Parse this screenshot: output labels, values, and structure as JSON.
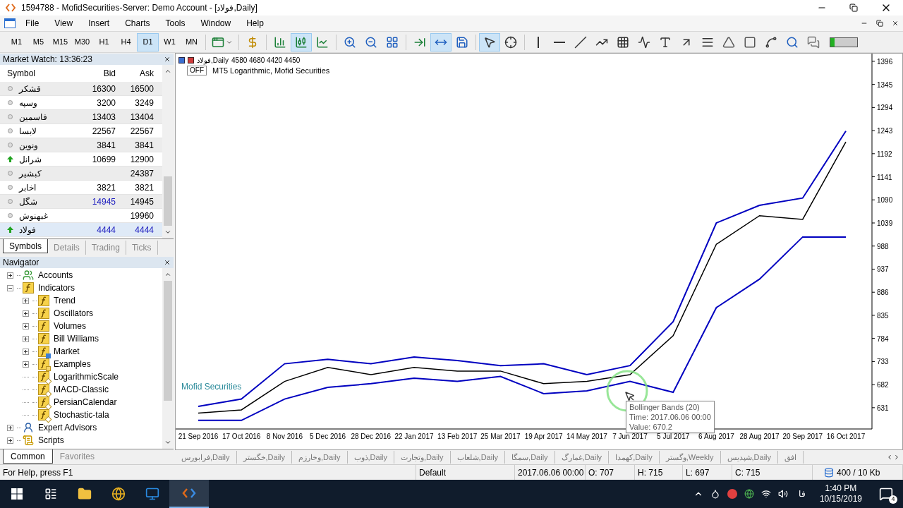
{
  "window": {
    "title": "1594788 - MofidSecurities-Server: Demo Account - [فولاد,Daily]"
  },
  "menu": [
    "File",
    "View",
    "Insert",
    "Charts",
    "Tools",
    "Window",
    "Help"
  ],
  "timeframes": [
    {
      "label": "M1",
      "selected": false
    },
    {
      "label": "M5",
      "selected": false
    },
    {
      "label": "M15",
      "selected": false
    },
    {
      "label": "M30",
      "selected": false
    },
    {
      "label": "H1",
      "selected": false
    },
    {
      "label": "H4",
      "selected": false
    },
    {
      "label": "D1",
      "selected": true
    },
    {
      "label": "W1",
      "selected": false
    },
    {
      "label": "MN",
      "selected": false
    }
  ],
  "toolbar_tools": [
    {
      "selected": false
    },
    {
      "selected": false
    },
    {
      "selected": false
    },
    {
      "selected": true
    },
    {
      "selected": false
    },
    {
      "selected": false
    },
    {
      "selected": false
    },
    {
      "selected": false
    },
    {
      "selected": false
    },
    {
      "selected": true
    },
    {
      "selected": false
    },
    {
      "selected": true
    },
    {
      "selected": false
    },
    {
      "selected": false
    },
    {
      "selected": false
    },
    {
      "selected": false
    },
    {
      "selected": false
    },
    {
      "selected": false
    },
    {
      "selected": false
    },
    {
      "selected": false
    },
    {
      "selected": false
    },
    {
      "selected": false
    },
    {
      "selected": false
    },
    {
      "selected": false
    },
    {
      "selected": false
    },
    {
      "selected": false
    },
    {
      "selected": false
    }
  ],
  "market_watch": {
    "title": "Market Watch: 13:36:23",
    "columns": [
      "Symbol",
      "Bid",
      "Ask"
    ],
    "rows": [
      {
        "symbol": "قشکر",
        "bid": "16300",
        "ask": "16500",
        "kind": "flat",
        "bid_highlight": false,
        "ask_highlight": false,
        "selected": false
      },
      {
        "symbol": "وسپه",
        "bid": "3200",
        "ask": "3249",
        "kind": "flat",
        "bid_highlight": false,
        "ask_highlight": false,
        "selected": false
      },
      {
        "symbol": "فاسمین",
        "bid": "13403",
        "ask": "13404",
        "kind": "flat",
        "bid_highlight": false,
        "ask_highlight": false,
        "selected": false
      },
      {
        "symbol": "لابسا",
        "bid": "22567",
        "ask": "22567",
        "kind": "flat",
        "bid_highlight": false,
        "ask_highlight": false,
        "selected": false
      },
      {
        "symbol": "ونوین",
        "bid": "3841",
        "ask": "3841",
        "kind": "flat",
        "bid_highlight": false,
        "ask_highlight": false,
        "selected": false
      },
      {
        "symbol": "شرانل",
        "bid": "10699",
        "ask": "12900",
        "kind": "up",
        "bid_highlight": false,
        "ask_highlight": false,
        "selected": false
      },
      {
        "symbol": "کبشیر",
        "ask": "24387",
        "kind": "flat",
        "ask_highlight": false,
        "selected": false
      },
      {
        "symbol": "اخابر",
        "bid": "3821",
        "ask": "3821",
        "kind": "flat",
        "bid_highlight": false,
        "ask_highlight": false,
        "selected": false
      },
      {
        "symbol": "شگل",
        "bid": "14945",
        "ask": "14945",
        "kind": "flat",
        "bid_highlight": true,
        "ask_highlight": false,
        "selected": false
      },
      {
        "symbol": "غبهنوش",
        "ask": "19960",
        "kind": "flat",
        "ask_highlight": false,
        "selected": false
      },
      {
        "symbol": "فولاد",
        "bid": "4444",
        "ask": "4444",
        "kind": "up",
        "bid_highlight": true,
        "ask_highlight": true,
        "selected": true
      }
    ],
    "tabs": [
      {
        "label": "Symbols",
        "selected": true
      },
      {
        "label": "Details",
        "selected": false
      },
      {
        "label": "Trading",
        "selected": false
      },
      {
        "label": "Ticks",
        "selected": false
      }
    ]
  },
  "navigator": {
    "title": "Navigator",
    "items": [
      {
        "label": "Accounts",
        "kind": "accounts",
        "expanded": false
      },
      {
        "label": "Indicators",
        "kind": "group",
        "expanded": true,
        "children": [
          {
            "label": "Trend",
            "kind": "group",
            "expanded": false
          },
          {
            "label": "Oscillators",
            "kind": "group",
            "expanded": false
          },
          {
            "label": "Volumes",
            "kind": "group",
            "expanded": false
          },
          {
            "label": "Bill Williams",
            "kind": "group",
            "expanded": false
          },
          {
            "label": "Market",
            "kind": "market",
            "expanded": false
          },
          {
            "label": "Examples",
            "kind": "examples",
            "expanded": false
          },
          {
            "label": "LogarithmicScale",
            "kind": "indicator"
          },
          {
            "label": "MACD-Classic",
            "kind": "indicator"
          },
          {
            "label": "PersianCalendar",
            "kind": "indicator"
          },
          {
            "label": "Stochastic-tala",
            "kind": "indicator"
          }
        ]
      },
      {
        "label": "Expert Advisors",
        "kind": "experts",
        "expanded": false
      },
      {
        "label": "Scripts",
        "kind": "scripts",
        "expanded": false
      }
    ],
    "tabs": [
      {
        "label": "Common",
        "selected": true
      },
      {
        "label": "Favorites",
        "selected": false
      }
    ]
  },
  "chart": {
    "symbol": "فولاد,Daily",
    "ohlc": "4580 4680 4420 4450",
    "scale_button": "OFF",
    "indicator_label": "MT5 Logarithmic, Mofid Securities",
    "broker_label": "Mofid Securities",
    "tooltip": [
      "Bollinger Bands (20)",
      "Time: 2017.06.06 00:00",
      "Value: 670.2"
    ],
    "chart_data": {
      "type": "line",
      "categories": [
        "21 Sep 2016",
        "17 Oct 2016",
        "8 Nov 2016",
        "5 Dec 2016",
        "28 Dec 2016",
        "22 Jan 2017",
        "13 Feb 2017",
        "25 Mar 2017",
        "19 Apr 2017",
        "14 May 2017",
        "7 Jun 2017",
        "5 Jul 2017",
        "6 Aug 2017",
        "28 Aug 2017",
        "20 Sep 2017",
        "16 Oct 2017"
      ],
      "series": [
        {
          "color": "#000000",
          "values": [
            619,
            626,
            689,
            720,
            704,
            720,
            712,
            712,
            684,
            689,
            704,
            790,
            992,
            1055,
            1047,
            1218
          ]
        },
        {
          "color": "#0000c0",
          "values": [
            634,
            650,
            728,
            738,
            728,
            743,
            735,
            724,
            728,
            704,
            724,
            821,
            1039,
            1078,
            1094,
            1242
          ]
        },
        {
          "color": "#0000c0",
          "values": [
            603,
            603,
            650,
            676,
            684,
            696,
            689,
            700,
            662,
            668,
            689,
            665,
            852,
            915,
            1008,
            1008
          ]
        }
      ],
      "ylim": [
        584,
        1413
      ],
      "yticks": [
        1396,
        1345,
        1294,
        1243,
        1192,
        1141,
        1090,
        1039,
        988,
        937,
        886,
        835,
        784,
        733,
        682,
        631
      ]
    }
  },
  "chart_tabs": [
    {
      "label": "فرابورس,Daily",
      "selected": false
    },
    {
      "label": "خگستر,Daily",
      "selected": false
    },
    {
      "label": "وخارزم,Daily",
      "selected": false
    },
    {
      "label": "ذوب,Daily",
      "selected": false
    },
    {
      "label": "وتجارت,Daily",
      "selected": false
    },
    {
      "label": "شلعاب,Daily",
      "selected": false
    },
    {
      "label": "سمگا,Daily",
      "selected": false
    },
    {
      "label": "غمارگ,Daily",
      "selected": false
    },
    {
      "label": "کهمدا,Daily",
      "selected": false
    },
    {
      "label": "وگستر,Weekly",
      "selected": false
    },
    {
      "label": "شپدیس,Daily",
      "selected": false
    },
    {
      "label": "افق",
      "selected": false
    }
  ],
  "status_bar": [
    "For Help, press F1",
    "Default",
    "2017.06.06 00:00",
    "O: 707",
    "H: 715",
    "L: 697",
    "C: 715",
    "400 / 10 Kb"
  ],
  "taskbar": {
    "language": "فا",
    "time": "1:40 PM",
    "date": "10/15/2019",
    "notifications": "4"
  }
}
